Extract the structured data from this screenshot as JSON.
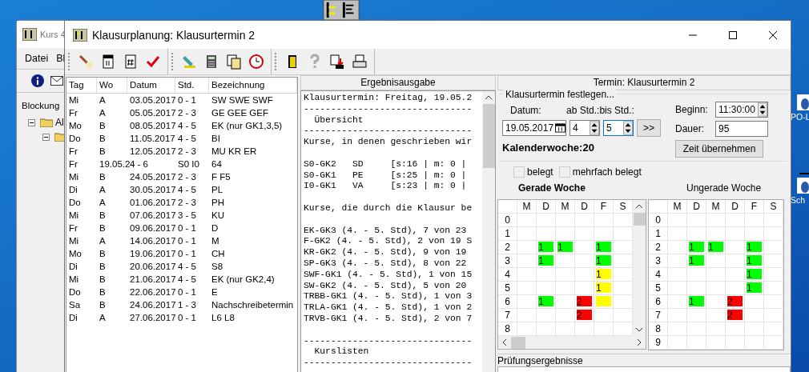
{
  "desktop": {
    "icons": [
      {
        "label": "PO-L"
      },
      {
        "label": "Sch"
      }
    ]
  },
  "background_window": {
    "title": "Kurs 4",
    "menu": [
      "Datei",
      "Bl"
    ],
    "tab": "Blockung",
    "tree": [
      {
        "label": "Al",
        "expanded": true,
        "children": [
          {
            "expanded": true
          }
        ]
      }
    ]
  },
  "window": {
    "title": "Klausurplanung: Klausurtermin 2"
  },
  "exam_list": {
    "columns": [
      "Tag",
      "Wo",
      "Datum",
      "Std.",
      "Bezeichnung"
    ],
    "rows": [
      [
        "Mi",
        "A",
        "03.05.2017",
        "0 - 1",
        "SW SWE SWF"
      ],
      [
        "Fr",
        "A",
        "05.05.2017",
        "2 - 3",
        "GE GEE GEF"
      ],
      [
        "Mo",
        "B",
        "08.05.2017",
        "4 - 5",
        "EK (nur GK1,3,5)"
      ],
      [
        "Do",
        "B",
        "11.05.2017",
        "4 - 5",
        "BI"
      ],
      [
        "Fr",
        "B",
        "12.05.2017",
        "2 - 3",
        "MU KR ER"
      ],
      [
        "Fr",
        "19.05.2",
        "4 - 6",
        "S0 I0",
        "64"
      ],
      [
        "Mi",
        "B",
        "24.05.2017",
        "2 - 3",
        "F F5"
      ],
      [
        "Di",
        "A",
        "30.05.2017",
        "4 - 5",
        "PL"
      ],
      [
        "Do",
        "A",
        "01.06.2017",
        "2 - 3",
        "PH"
      ],
      [
        "Mi",
        "B",
        "07.06.2017",
        "3 - 5",
        "KU"
      ],
      [
        "Fr",
        "B",
        "09.06.2017",
        "0 - 1",
        "D"
      ],
      [
        "Mi",
        "A",
        "14.06.2017",
        "0 - 1",
        "M"
      ],
      [
        "Mo",
        "B",
        "19.06.2017",
        "0 - 1",
        "CH"
      ],
      [
        "Di",
        "B",
        "20.06.2017",
        "4 - 5",
        "S8"
      ],
      [
        "Mi",
        "B",
        "21.06.2017",
        "4 - 5",
        "EK (nur GK2,4)"
      ],
      [
        "Do",
        "B",
        "22.06.2017",
        "0 - 1",
        "E"
      ],
      [
        "Sa",
        "B",
        "24.06.2017",
        "1 - 3",
        "Nachschreibetermin"
      ],
      [
        "Di",
        "A",
        "27.06.2017",
        "0 - 1",
        "L6 L8"
      ]
    ]
  },
  "output": {
    "title": "Ergebnisausgabe",
    "lines": [
      {
        "kind": "text",
        "text": "Klausurtermin: Freitag, 19.05.2"
      },
      {
        "kind": "text",
        "text": "-------------------------------"
      },
      {
        "kind": "text",
        "text": "  Übersicht"
      },
      {
        "kind": "text",
        "text": "-------------------------------"
      },
      {
        "kind": "text",
        "text": "Kurse, in denen geschrieben wir"
      },
      {
        "kind": "blank"
      },
      {
        "kind": "text",
        "text": "S0-GK2   SD     [s:16 | m: 0 |"
      },
      {
        "kind": "text",
        "text": "S0-GK1   PE     [s:25 | m: 0 |"
      },
      {
        "kind": "text",
        "text": "I0-GK1   VA     [s:23 | m: 0 |"
      },
      {
        "kind": "blank"
      },
      {
        "kind": "text",
        "text": "Kurse, die durch die Klausur be"
      },
      {
        "kind": "blank"
      },
      {
        "kind": "text",
        "text": "EK-GK3 (4. - 5. Std), 7 von 23"
      },
      {
        "kind": "text",
        "text": "F-GK2 (4. - 5. Std), 2 von 19 S"
      },
      {
        "kind": "text",
        "text": "KR-GK2 (4. - 5. Std), 9 von 19"
      },
      {
        "kind": "text",
        "text": "SP-GK3 (4. - 5. Std), 8 von 22"
      },
      {
        "kind": "text",
        "text": "SWF-GK1 (4. - 5. Std), 1 von 15"
      },
      {
        "kind": "text",
        "text": "SW-GK2 (4. - 5. Std), 5 von 20"
      },
      {
        "kind": "text",
        "text": "TRBB-GK1 (4. - 5. Std), 1 von 3"
      },
      {
        "kind": "text",
        "text": "TRLA-GK1 (4. - 5. Std), 1 von 2"
      },
      {
        "kind": "text",
        "text": "TRVB-GK1 (4. - 5. Std), 2 von 7"
      },
      {
        "kind": "blank"
      },
      {
        "kind": "text",
        "text": "-------------------------------"
      },
      {
        "kind": "text",
        "text": "  Kurslisten"
      },
      {
        "kind": "text",
        "text": "-------------------------------"
      }
    ]
  },
  "termin": {
    "title": "Termin: Klausurtermin 2",
    "group_title": "Klausurtermin festlegen...",
    "date_label": "Datum:",
    "date": "19.05.2017",
    "from_label": "ab Std.:",
    "from": "4",
    "to_label": "bis Std.:",
    "to": "5",
    "next_button": ">>",
    "begin_label": "Beginn:",
    "begin": "11:30:00",
    "duration_label": "Dauer:",
    "duration": "95",
    "apply_button": "Zeit übernehmen",
    "calendar_week": "Kalenderwoche:20",
    "legend": [
      {
        "label": "belegt",
        "checked": false
      },
      {
        "label": "mehrfach belegt",
        "checked": false
      }
    ],
    "weeks": [
      {
        "title": "Gerade Woche",
        "selected": true,
        "scrollbars": true,
        "columns": [
          "M",
          "D",
          "M",
          "D",
          "F",
          "S"
        ],
        "rows": [
          {
            "label": "0",
            "cells": [
              null,
              null,
              null,
              null,
              null,
              null
            ]
          },
          {
            "label": "1",
            "cells": [
              null,
              null,
              null,
              null,
              null,
              null
            ]
          },
          {
            "label": "2",
            "cells": [
              null,
              {
                "text": "1",
                "color": "#00ff00"
              },
              {
                "text": "1",
                "color": "#00ff00"
              },
              null,
              {
                "text": "1",
                "color": "#00ff00"
              },
              null
            ]
          },
          {
            "label": "3",
            "cells": [
              null,
              {
                "text": "1",
                "color": "#00ff00"
              },
              null,
              null,
              {
                "text": "1",
                "color": "#00ff00"
              },
              null
            ]
          },
          {
            "label": "4",
            "cells": [
              null,
              null,
              null,
              null,
              {
                "text": "1",
                "color": "#ffff00"
              },
              null
            ]
          },
          {
            "label": "5",
            "cells": [
              null,
              null,
              null,
              null,
              {
                "text": "1",
                "color": "#ffff00"
              },
              null
            ]
          },
          {
            "label": "6",
            "cells": [
              null,
              {
                "text": "1",
                "color": "#00ff00"
              },
              null,
              {
                "text": "2",
                "color": "#ff0000"
              },
              {
                "color": "#ffff00"
              },
              null
            ]
          },
          {
            "label": "7",
            "cells": [
              null,
              null,
              null,
              {
                "text": "2",
                "color": "#ff0000"
              },
              null,
              null
            ]
          },
          {
            "label": "8",
            "cells": [
              null,
              null,
              null,
              null,
              null,
              null
            ]
          }
        ]
      },
      {
        "title": "Ungerade Woche",
        "selected": false,
        "scrollbars": false,
        "columns": [
          "M",
          "D",
          "M",
          "D",
          "F",
          "S"
        ],
        "rows": [
          {
            "label": "0",
            "cells": [
              null,
              null,
              null,
              null,
              null,
              null
            ]
          },
          {
            "label": "1",
            "cells": [
              null,
              null,
              null,
              null,
              null,
              null
            ]
          },
          {
            "label": "2",
            "cells": [
              null,
              {
                "text": "1",
                "color": "#00ff00"
              },
              {
                "text": "1",
                "color": "#00ff00"
              },
              null,
              {
                "text": "1",
                "color": "#00ff00"
              },
              null
            ]
          },
          {
            "label": "3",
            "cells": [
              null,
              {
                "text": "1",
                "color": "#00ff00"
              },
              null,
              null,
              {
                "text": "1",
                "color": "#00ff00"
              },
              null
            ]
          },
          {
            "label": "4",
            "cells": [
              null,
              null,
              null,
              null,
              {
                "text": "1",
                "color": "#00ff00"
              },
              null
            ]
          },
          {
            "label": "5",
            "cells": [
              null,
              null,
              null,
              null,
              {
                "text": "1",
                "color": "#00ff00"
              },
              null
            ]
          },
          {
            "label": "6",
            "cells": [
              null,
              {
                "text": "1",
                "color": "#00ff00"
              },
              null,
              {
                "text": "2",
                "color": "#ff0000"
              },
              null,
              null
            ]
          },
          {
            "label": "7",
            "cells": [
              null,
              null,
              null,
              {
                "text": "2",
                "color": "#ff0000"
              },
              null,
              null
            ]
          },
          {
            "label": "8",
            "cells": [
              null,
              null,
              null,
              null,
              null,
              null
            ]
          },
          {
            "label": "9",
            "cells": [
              null,
              null,
              null,
              null,
              null,
              null
            ]
          }
        ]
      }
    ],
    "results_title": "Prüfungsergebnisse"
  }
}
